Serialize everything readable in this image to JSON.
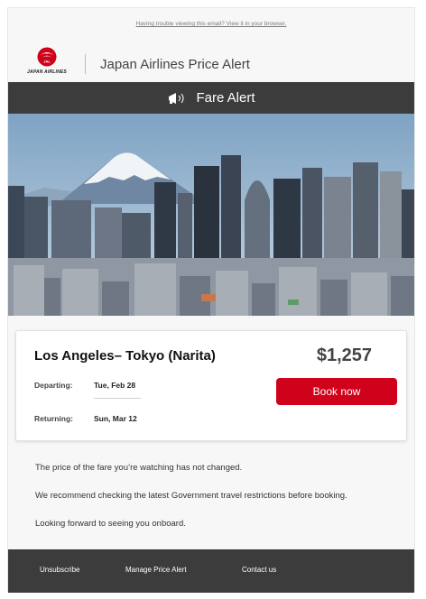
{
  "preheader": {
    "text": "Having trouble viewing this email? View it in your browser."
  },
  "brand": {
    "logo_text": "JAPAN AIRLINES",
    "logo_mark_text": "JAL",
    "title": "Japan Airlines Price Alert"
  },
  "alert_bar": {
    "icon": "megaphone-icon",
    "title": "Fare Alert"
  },
  "hero": {
    "description_icon": "mount-fuji-tokyo-skyline-image"
  },
  "fare": {
    "route": "Los Angeles– Tokyo (Narita)",
    "price": "$1,257",
    "departing_label": "Departing:",
    "departing_date": "Tue, Feb 28",
    "returning_label": "Returning:",
    "returning_date": "Sun, Mar 12",
    "book_label": "Book now"
  },
  "messages": [
    "The price of the fare you’re watching has not changed.",
    "We recommend checking the latest Government travel restrictions before booking.",
    "Looking forward to seeing you onboard."
  ],
  "footer": {
    "links": [
      "Unsubscribe",
      "Manage Price Alert",
      "Contact us"
    ]
  },
  "colors": {
    "brand_red": "#d0021b",
    "dark_bar": "#3c3c3c",
    "background": "#f7f7f7"
  }
}
